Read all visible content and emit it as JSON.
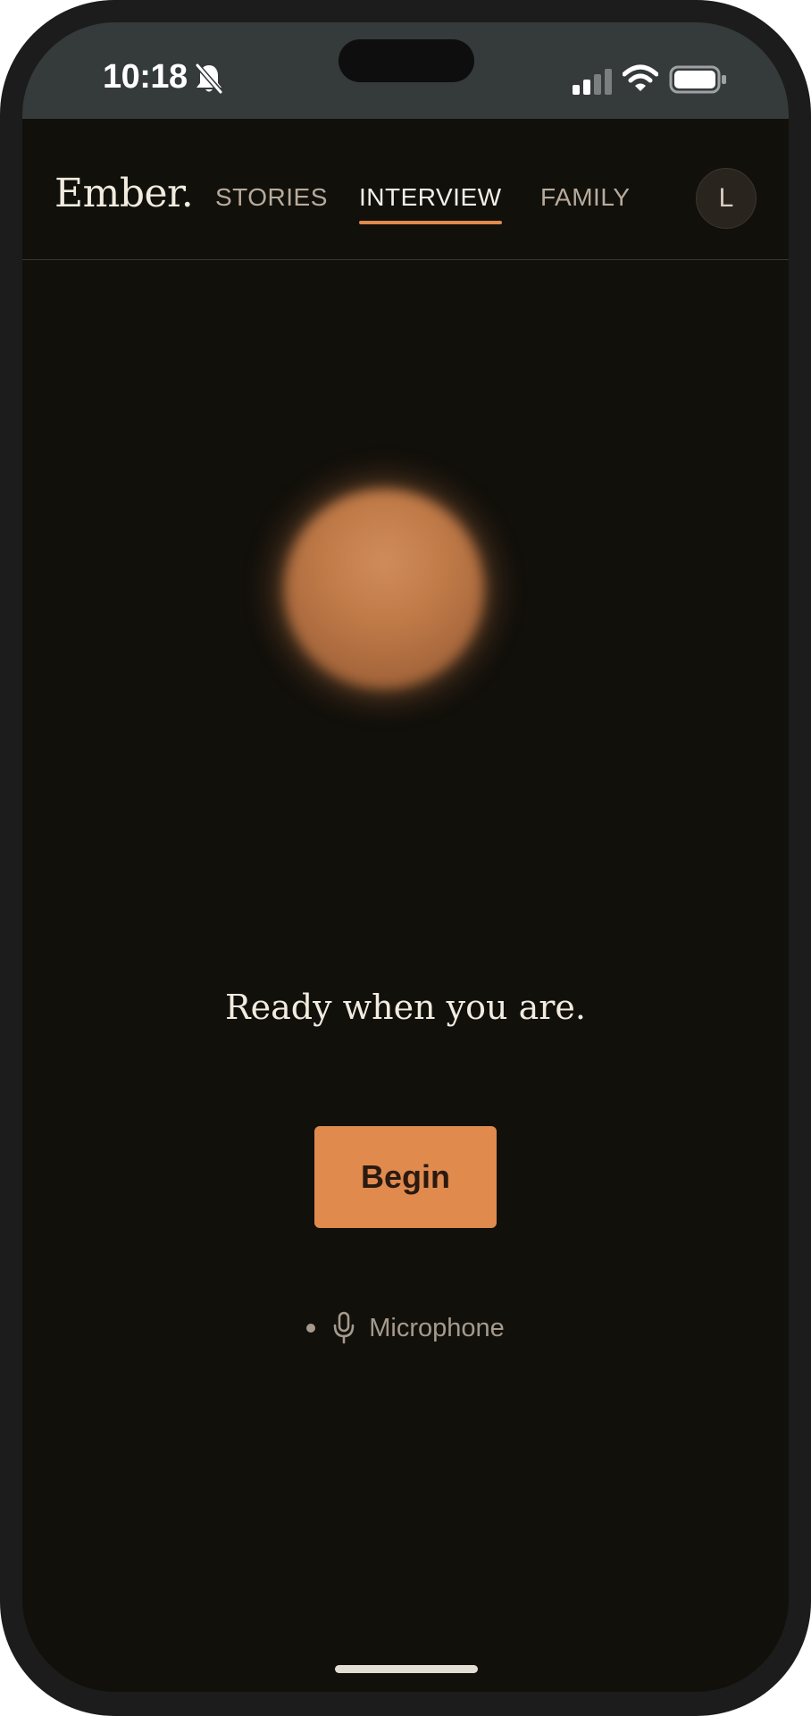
{
  "status_bar": {
    "time": "10:18",
    "icons": [
      "bell-slash-icon",
      "signal-icon",
      "wifi-icon",
      "battery-icon"
    ]
  },
  "header": {
    "brand": "Ember.",
    "tabs": [
      {
        "label": "STORIES",
        "active": false
      },
      {
        "label": "INTERVIEW",
        "active": true
      },
      {
        "label": "FAMILY",
        "active": false
      }
    ],
    "avatar_initial": "L"
  },
  "main": {
    "prompt_text": "Ready when you are.",
    "begin_label": "Begin",
    "mic_label": "Microphone",
    "mic_icon": "microphone-icon"
  },
  "colors": {
    "background": "#12100b",
    "accent": "#e08a4e",
    "orb": "#c07a48",
    "text_primary": "#f1ebe0",
    "text_muted": "#a59a8d"
  }
}
